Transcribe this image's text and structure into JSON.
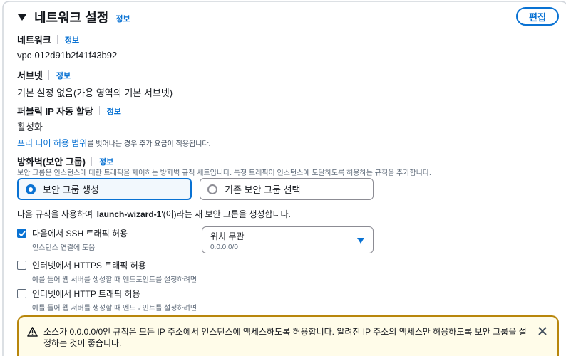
{
  "header": {
    "title": "네트워크 설정",
    "info": "정보",
    "edit_label": "편집"
  },
  "network": {
    "label": "네트워크",
    "info": "정보",
    "value": "vpc-012d91b2f41f43b92"
  },
  "subnet": {
    "label": "서브넷",
    "info": "정보",
    "value": "기본 설정 없음(가용 영역의 기본 서브넷)"
  },
  "public_ip": {
    "label": "퍼블릭 IP 자동 할당",
    "info": "정보",
    "value": "활성화",
    "note_link": "프리 티어 허용 범위",
    "note_rest": "를 벗어나는 경우 추가 요금이 적용됩니다."
  },
  "firewall": {
    "label": "방화벽(보안 그룹)",
    "info": "정보",
    "description": "보안 그룹은 인스턴스에 대한 트래픽을 제어하는 방화벽 규칙 세트입니다. 특정 트래픽이 인스턴스에 도달하도록 허용하는 규칙을 추가합니다.",
    "options": [
      {
        "label": "보안 그룹 생성",
        "selected": true
      },
      {
        "label": "기존 보안 그룹 선택",
        "selected": false
      }
    ]
  },
  "rules": {
    "prefix": "다음 규칙을 사용하여 '",
    "group_name": "launch-wizard-1",
    "suffix": "'(이)라는 새 보안 그룹을 생성합니다.",
    "items": [
      {
        "label": "다음에서 SSH 트래픽 허용",
        "sub": "인스턴스 연결에 도움",
        "checked": true
      },
      {
        "label": "인터넷에서 HTTPS 트래픽 허용",
        "sub": "예를 들어 웹 서버를 생성할 때 엔드포인트를 설정하려면",
        "checked": false
      },
      {
        "label": "인터넷에서 HTTP 트래픽 허용",
        "sub": "예를 들어 웹 서버를 생성할 때 엔드포인트를 설정하려면",
        "checked": false
      }
    ],
    "source_select": {
      "value": "위치 무관",
      "sub": "0.0.0.0/0"
    }
  },
  "alert": {
    "message": "소스가 0.0.0.0/0인 규칙은 모든 IP 주소에서 인스턴스에 액세스하도록 허용합니다. 알려진 IP 주소의 액세스만 허용하도록 보안 그룹을 설정하는 것이 좋습니다."
  },
  "colors": {
    "accent": "#0972d3",
    "warning_border": "#b8860b",
    "warning_bg": "#fffce9"
  },
  "icons": {
    "caret": "caret-down-icon",
    "warning": "warning-icon",
    "close": "close-icon",
    "dropdown": "dropdown-arrow-icon",
    "check": "check-icon"
  }
}
